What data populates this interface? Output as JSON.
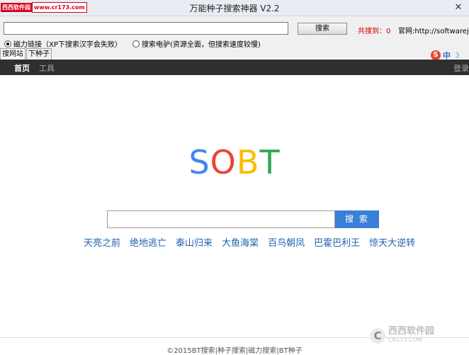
{
  "window": {
    "title": "万能种子搜索神器 V2.2",
    "close": "✕",
    "watermark": {
      "brand": "西西软件园",
      "url": "www.cr173.com"
    }
  },
  "toolbar": {
    "search_value": "",
    "search_button": "搜索",
    "found_label": "共搜到：0",
    "official_site": "官网:http://softwarejxk"
  },
  "options": [
    {
      "label": "磁力链接（XP下搜索汉字会失败）",
      "selected": true
    },
    {
      "label": "搜索电驴(资源全面，但搜索速度较慢)",
      "selected": false
    }
  ],
  "tabs": [
    {
      "label": "搜网站",
      "active": true
    },
    {
      "label": "下种子",
      "active": false
    }
  ],
  "ime": {
    "s": "S",
    "zh": "中",
    "moon": "☽"
  },
  "nav": {
    "home": "首页",
    "tools": "工具",
    "login": "登录"
  },
  "logo": {
    "letters": [
      {
        "char": "S",
        "color": "#4285f4"
      },
      {
        "char": "O",
        "color": "#ea4335"
      },
      {
        "char": "B",
        "color": "#fbbc05"
      },
      {
        "char": "T",
        "color": "#34a853"
      }
    ]
  },
  "main_search": {
    "value": "",
    "button": "搜 索"
  },
  "hot_searches": [
    "天亮之前",
    "绝地逃亡",
    "泰山归来",
    "大鱼海棠",
    "百鸟朝凤",
    "巴霍巴利王",
    "惊天大逆转"
  ],
  "footer": "©2015BT搜索|种子搜索|磁力搜索|BT种子",
  "corner_watermark": {
    "icon": "C",
    "name": "西西软件园",
    "url": "CR173.COM"
  }
}
